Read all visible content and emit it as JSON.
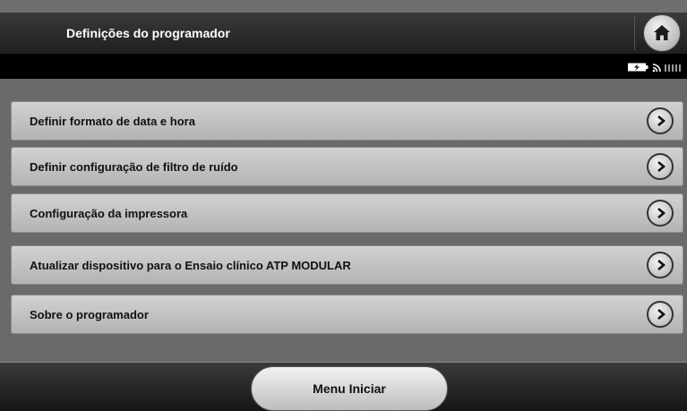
{
  "header": {
    "title": "Definições do programador",
    "home_icon": "home-icon"
  },
  "status": {
    "icons": [
      "battery-charging-icon",
      "wireless-icon",
      "signal-bars-icon"
    ]
  },
  "menu": {
    "items": [
      {
        "label": "Definir formato de data e hora"
      },
      {
        "label": "Definir configuração de filtro de ruído"
      },
      {
        "label": "Configuração da impressora"
      },
      {
        "label": "Atualizar dispositivo para o Ensaio clínico ATP MODULAR"
      },
      {
        "label": "Sobre o programador"
      }
    ]
  },
  "footer": {
    "button_label": "Menu Iniciar"
  },
  "colors": {
    "header_bg": "#2a2a2a",
    "status_bg": "#000000",
    "row_bg": "#c4c4c4",
    "content_bg": "#6a6a6a"
  }
}
